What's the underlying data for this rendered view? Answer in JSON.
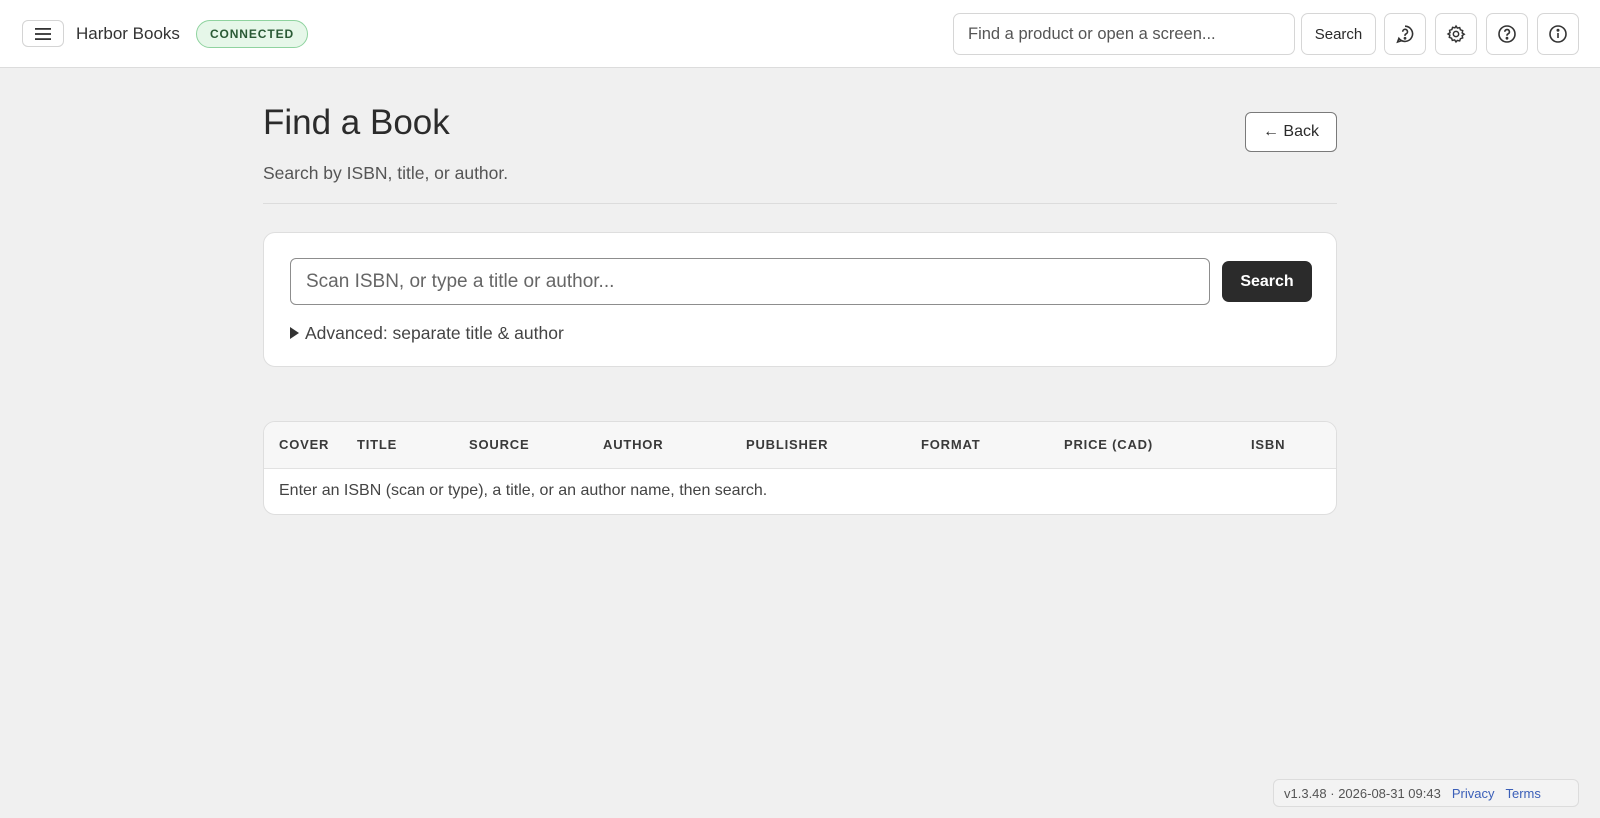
{
  "header": {
    "brand": "Harbor Books",
    "status_badge": "CONNECTED",
    "search_placeholder": "Find a product or open a screen...",
    "search_button": "Search",
    "icons": [
      "menu-icon",
      "assistant-icon",
      "gear-icon",
      "help-icon",
      "info-icon"
    ]
  },
  "page": {
    "title": "Find a Book",
    "subtitle": "Search by ISBN, title, or author.",
    "back_button": "← Back"
  },
  "search": {
    "placeholder": "Scan ISBN, or type a title or author...",
    "value": "",
    "button": "Search",
    "advanced_label": "Advanced: separate title & author",
    "advanced_expanded": false
  },
  "results": {
    "columns": [
      "COVER",
      "TITLE",
      "SOURCE",
      "AUTHOR",
      "PUBLISHER",
      "FORMAT",
      "PRICE (CAD)",
      "ISBN"
    ],
    "empty_message": "Enter an ISBN (scan or type), a title, or an author name, then search.",
    "rows": []
  },
  "footer": {
    "version": "v1.3.48 · 2026-08-31 09:43",
    "privacy": "Privacy",
    "terms": "Terms"
  },
  "colors": {
    "background": "#f0f0f0",
    "primary_button": "#2b2b2b",
    "badge_bg": "#e6f7e9",
    "badge_border": "#8fd39f",
    "link": "#3b5fb8"
  }
}
